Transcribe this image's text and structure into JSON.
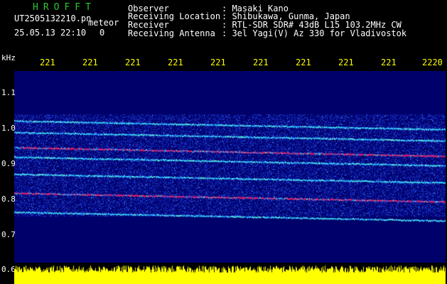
{
  "app": {
    "title": "HROFFT",
    "filename": "UT2505132210.pn",
    "type_label": "meteor",
    "datetime": "25.05.13 22:10",
    "counter": "0"
  },
  "info": {
    "observer_label": "Observer",
    "observer_value": ": Masaki Kano",
    "location_label": "Receiving Location",
    "location_value": ": Shibukawa, Gunma, Japan",
    "receiver_label": "Receiver",
    "receiver_value": ": RTL-SDR SDR# 43dB L15 103.2MHz CW",
    "antenna_label": "Receiving Antenna",
    "antenna_value": ": 3el Yagi(V) Az 330 for Vladivostok"
  },
  "axes": {
    "y_unit": "kHz",
    "x_ticks": [
      "221",
      "221",
      "221",
      "221",
      "221",
      "221",
      "221",
      "221",
      "221",
      "2220"
    ],
    "y_ticks": [
      "1.1",
      "1.0",
      "0.9",
      "0.8",
      "0.7",
      "0.6"
    ]
  },
  "spectrogram": {
    "background_color": "#00006a",
    "noise_color": "#1d3bd8",
    "line_color_cyan": "#34e0ff",
    "line_color_red": "#ff2060",
    "signal_color": "#ffff00",
    "freq_range_khz": [
      0.6,
      1.16
    ],
    "lines_khz": [
      1.03,
      1.0,
      0.96,
      0.935,
      0.89,
      0.84,
      0.79
    ]
  }
}
